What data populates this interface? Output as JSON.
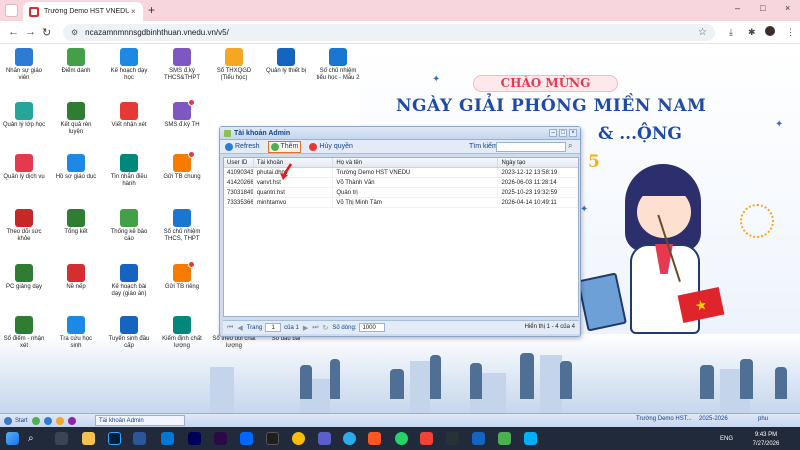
{
  "browser": {
    "tab_title": "Trường Demo HST VNEDU - Liê",
    "close_glyph": "×",
    "new_tab_glyph": "+",
    "url": "ncazamnmnnsgdbinhthuan.vnedu.vn/v5/",
    "window_controls": [
      "–",
      "□",
      "×"
    ]
  },
  "banner": {
    "greeting": "CHÀO MỪNG",
    "title": "NGÀY GIẢI PHÓNG MIỀN NAM",
    "subtitle": "& ...ỘNG",
    "number": "5"
  },
  "desktop_icons": [
    {
      "label": "Nhân sự giáo viên",
      "color": "#2e7bd6",
      "badge": false
    },
    {
      "label": "Điểm danh",
      "color": "#43a047",
      "badge": false
    },
    {
      "label": "Kế hoạch dạy học",
      "color": "#1e88e5",
      "badge": false
    },
    {
      "label": "SMS đ.ký THCS&THPT",
      "color": "#7e57c2",
      "badge": false
    },
    {
      "label": "Sổ THXQGD (Tiểu học)",
      "color": "#f5a623",
      "badge": false
    },
    {
      "label": "Quản lý thiết bị",
      "color": "#1565c0",
      "badge": false
    },
    {
      "label": "Số chủ nhiệm tiểu học - Mẫu 2",
      "color": "#1976d2",
      "badge": false
    },
    {
      "label": "Quản lý lớp học",
      "color": "#26a69a",
      "badge": false
    },
    {
      "label": "Kết quả rèn luyện",
      "color": "#2e7d32",
      "badge": false
    },
    {
      "label": "Viết nhận xét",
      "color": "#e53935",
      "badge": false
    },
    {
      "label": "SMS đ.ký TH",
      "color": "#7e57c2",
      "badge": true
    },
    {
      "label": "Quản lý dịch vụ",
      "color": "#e53950",
      "badge": false
    },
    {
      "label": "Hồ sơ giáo dục",
      "color": "#1e88e5",
      "badge": false
    },
    {
      "label": "Tin nhắn điều hành",
      "color": "#00897b",
      "badge": false
    },
    {
      "label": "Gửi TB chung",
      "color": "#f57c00",
      "badge": true
    },
    {
      "label": "Theo dõi sức khỏe",
      "color": "#c62828",
      "badge": false
    },
    {
      "label": "Tổng kết",
      "color": "#2e7d32",
      "badge": false
    },
    {
      "label": "Thống kê báo cáo",
      "color": "#43a047",
      "badge": false
    },
    {
      "label": "Sổ chủ nhiệm THCS, THPT",
      "color": "#1976d2",
      "badge": false
    },
    {
      "label": "PC giảng dạy",
      "color": "#2e7d32",
      "badge": false
    },
    {
      "label": "Nề nếp",
      "color": "#d32f2f",
      "badge": false
    },
    {
      "label": "Kế hoạch bài dạy (giáo án)",
      "color": "#1565c0",
      "badge": false
    },
    {
      "label": "Gửi TB riêng",
      "color": "#f57c00",
      "badge": true
    },
    {
      "label": "Sổ điểm - nhận xét",
      "color": "#2e7d32",
      "badge": false
    },
    {
      "label": "Tra cứu học sinh",
      "color": "#1e88e5",
      "badge": false
    },
    {
      "label": "Tuyển sinh đầu cấp",
      "color": "#1565c0",
      "badge": false
    },
    {
      "label": "Kiểm định chất lượng",
      "color": "#00897b",
      "badge": false
    },
    {
      "label": "Sổ theo dõi chất lượng",
      "color": "#0277bd",
      "badge": false
    },
    {
      "label": "Sổ đầu bài",
      "color": "#1565c0",
      "badge": false
    }
  ],
  "window": {
    "title": "Tài khoản Admin",
    "toolbar": {
      "refresh": "Refresh",
      "add": "Thêm",
      "revoke": "Hủy quyền",
      "search_label": "Tìm kiếm:",
      "search_value": ""
    },
    "columns": [
      "User ID",
      "Tài khoản",
      "Họ và tên",
      "Ngày tạo"
    ],
    "rows": [
      [
        "41090343...",
        "phutai.dhnv",
        "Trường Demo HST VNEDU",
        "2023-12-12 13:58:19"
      ],
      [
        "41420266...",
        "vanvt.hst",
        "Võ Thành Văn",
        "2026-06-03 11:28:14"
      ],
      [
        "73031849...",
        "quantri.hst",
        "Quản trị",
        "2025-10-23 19:32:59"
      ],
      [
        "73335366...",
        "minhtamvo",
        "Võ Thị Minh Tâm",
        "2026-04-14 10:49:11"
      ]
    ],
    "pager": {
      "page_label": "Trang",
      "page_value": "1",
      "of_label": "của 1",
      "rows_label": "Số dòng:",
      "rows_value": "1000",
      "info": "Hiển thị 1 - 4 của 4"
    }
  },
  "app_taskbar": {
    "start": "Start",
    "task_item": "Tài khoản Admin",
    "school": "Trường Demo HST...",
    "year": "2025-2026",
    "user": "phu"
  },
  "os_taskbar": {
    "lang": "ENG",
    "time": "9:43 PM",
    "date": "7/27/2026"
  }
}
